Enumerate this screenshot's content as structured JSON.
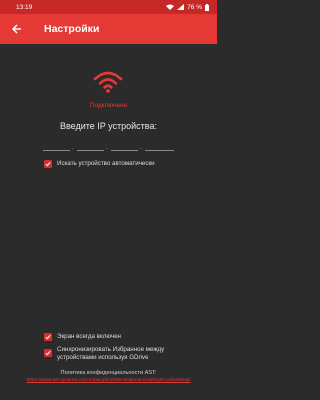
{
  "status_bar": {
    "time": "13:19",
    "battery": "76 %"
  },
  "app_bar": {
    "title": "Настройки"
  },
  "connection": {
    "status": "Подключено"
  },
  "ip": {
    "label": "Введите IP устройства:",
    "segments": [
      "",
      "",
      "",
      ""
    ]
  },
  "options": {
    "auto_search": "Искать устройство автоматически",
    "screen_on": "Экран всегда включен",
    "sync_favorites": "Синхронизировать Избранное между устройствами используя GDrive"
  },
  "footer": {
    "privacy_label": "Политика конфиденциальности AST:",
    "privacy_url": "https://www.ast-systems.ru/company/konfidentsialnost-mobilnykh-prilozheniy/"
  },
  "colors": {
    "accent": "#e53935",
    "statusbar": "#c62828",
    "background": "#2b2b2b"
  }
}
